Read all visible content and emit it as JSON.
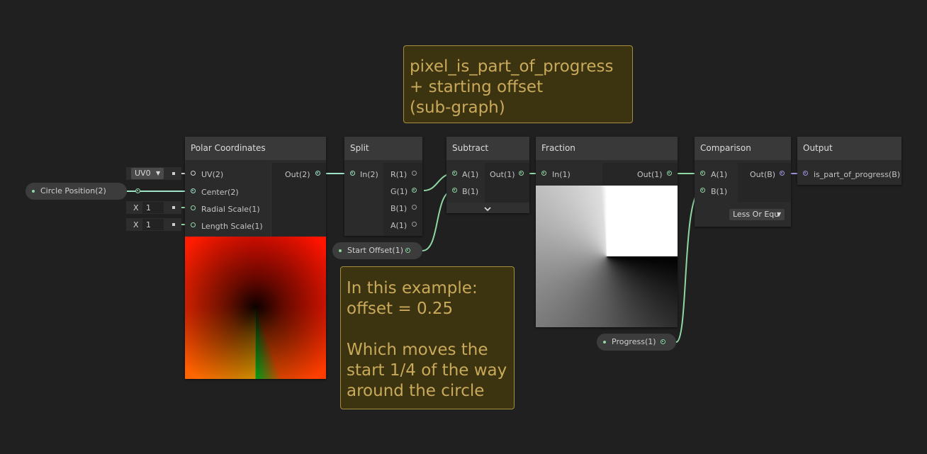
{
  "sticky_top": {
    "text": "pixel_is_part_of_progress\n+ starting offset\n(sub-graph)"
  },
  "sticky_bottom": {
    "text": "In this example:\noffset = 0.25\n\nWhich moves the\nstart 1/4 of the way\naround the circle"
  },
  "properties": {
    "circle_position": "Circle Position(2)",
    "start_offset": "Start Offset(1)",
    "progress": "Progress(1)"
  },
  "inline_inputs": {
    "uv_channel": "UV0",
    "radial_axis": "X",
    "radial_value": "1",
    "length_axis": "X",
    "length_value": "1"
  },
  "nodes": {
    "polar": {
      "title": "Polar Coordinates",
      "inputs": [
        "UV(2)",
        "Center(2)",
        "Radial Scale(1)",
        "Length Scale(1)"
      ],
      "output": "Out(2)"
    },
    "split": {
      "title": "Split",
      "input": "In(2)",
      "outputs": [
        "R(1)",
        "G(1)",
        "B(1)",
        "A(1)"
      ]
    },
    "subtract": {
      "title": "Subtract",
      "inputs": [
        "A(1)",
        "B(1)"
      ],
      "output": "Out(1)"
    },
    "fraction": {
      "title": "Fraction",
      "input": "In(1)",
      "output": "Out(1)"
    },
    "comparison": {
      "title": "Comparison",
      "inputs": [
        "A(1)",
        "B(1)"
      ],
      "output": "Out(B)",
      "mode": "Less Or Equ"
    },
    "output": {
      "title": "Output",
      "input": "is_part_of_progress(B)"
    }
  },
  "colors": {
    "background": "#202020",
    "wire_float": "#8fd7a3",
    "wire_vector2": "#9de3c7",
    "wire_bool": "#9b95e0",
    "sticky_fill": "#3c3311",
    "sticky_border": "#a58e3d"
  },
  "icons": {
    "collapse": "chevron-down-icon",
    "dropdown": "caret-down-icon"
  }
}
